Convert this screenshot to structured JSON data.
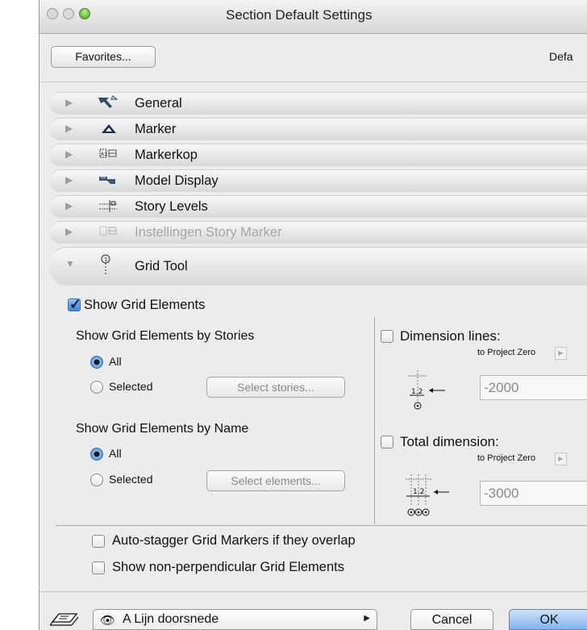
{
  "window": {
    "title": "Section Default Settings"
  },
  "header": {
    "favorites_label": "Favorites...",
    "defaults_label": "Defa"
  },
  "panels": [
    {
      "label": "General",
      "icon": "general-icon"
    },
    {
      "label": "Marker",
      "icon": "marker-triangle-icon"
    },
    {
      "label": "Markerkop",
      "icon": "markerkop-icon"
    },
    {
      "label": "Model Display",
      "icon": "model-display-icon"
    },
    {
      "label": "Story Levels",
      "icon": "story-levels-icon"
    },
    {
      "label": "Instellingen Story Marker",
      "icon": "story-marker-icon",
      "disabled": true
    },
    {
      "label": "Grid Tool",
      "icon": "grid-tool-icon",
      "expanded": true
    }
  ],
  "grid_tool": {
    "show_grid_elements": {
      "label": "Show Grid Elements",
      "checked": true
    },
    "by_stories": {
      "heading": "Show Grid Elements by Stories",
      "options": [
        "All",
        "Selected"
      ],
      "selected": "All",
      "button": "Select stories..."
    },
    "by_name": {
      "heading": "Show Grid Elements by Name",
      "options": [
        "All",
        "Selected"
      ],
      "selected": "All",
      "button": "Select elements..."
    },
    "dimension_lines": {
      "label": "Dimension lines:",
      "checked": false,
      "reference": "to Project Zero",
      "value": "-2000",
      "diagram_label": "1.2"
    },
    "total_dimension": {
      "label": "Total dimension:",
      "checked": false,
      "reference": "to Project Zero",
      "value": "-3000",
      "diagram_label": "1.2"
    },
    "auto_stagger": {
      "label": "Auto-stagger Grid Markers if they overlap",
      "checked": false
    },
    "non_perpendicular": {
      "label": "Show non-perpendicular Grid Elements",
      "checked": false
    }
  },
  "footer": {
    "layer_label": "A Lijn doorsnede",
    "cancel_label": "Cancel",
    "ok_label": "OK"
  }
}
